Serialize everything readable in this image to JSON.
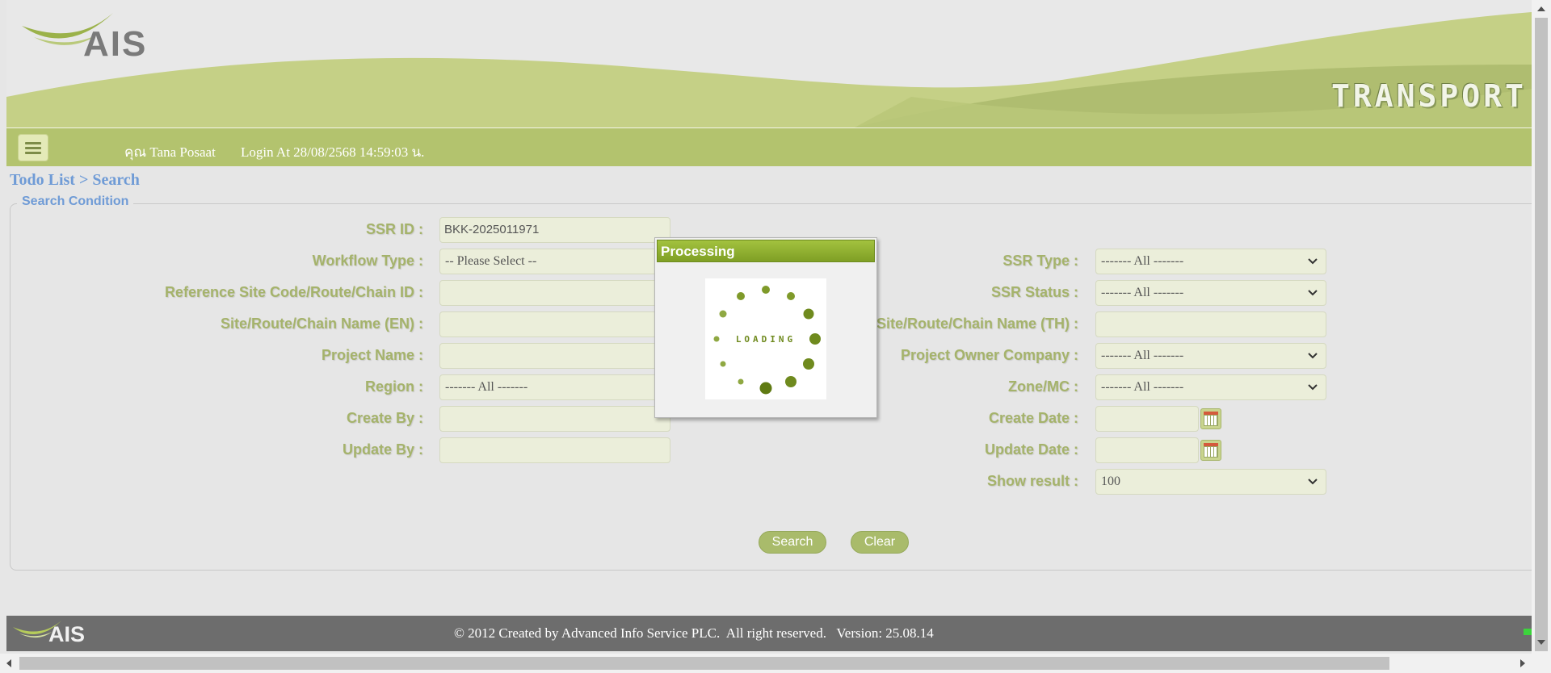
{
  "header": {
    "logo_text": "AIS",
    "brand_text": "TRANSPORT",
    "user_name": "คุณ Tana Posaat",
    "login_at": "Login At 28/08/2568 14:59:03 น."
  },
  "breadcrumb": "Todo List > Search",
  "search": {
    "legend": "Search Condition",
    "left": {
      "ssr_id_label": "SSR ID :",
      "ssr_id_value": "BKK-2025011971",
      "workflow_type_label": "Workflow Type :",
      "workflow_type_value": "-- Please Select --",
      "ref_site_label": "Reference Site Code/Route/Chain ID :",
      "ref_site_value": "",
      "site_name_en_label": "Site/Route/Chain Name (EN) :",
      "site_name_en_value": "",
      "project_name_label": "Project Name :",
      "project_name_value": "",
      "region_label": "Region :",
      "region_value": "------- All -------",
      "create_by_label": "Create By :",
      "create_by_value": "",
      "update_by_label": "Update By :",
      "update_by_value": ""
    },
    "right": {
      "ssr_type_label": "SSR Type :",
      "ssr_type_value": "------- All -------",
      "ssr_status_label": "SSR Status :",
      "ssr_status_value": "------- All -------",
      "site_name_th_label": "Site/Route/Chain Name (TH) :",
      "site_name_th_value": "",
      "project_owner_label": "Project Owner Company :",
      "project_owner_value": "------- All -------",
      "zone_mc_label": "Zone/MC :",
      "zone_mc_value": "------- All -------",
      "create_date_label": "Create Date :",
      "create_date_value": "",
      "update_date_label": "Update Date :",
      "update_date_value": "",
      "show_result_label": "Show result :",
      "show_result_value": "100"
    },
    "search_button": "Search",
    "clear_button": "Clear"
  },
  "footer": {
    "logo_text": "AIS",
    "copyright": "© 2012 Created by Advanced Info Service PLC.  All right reserved.   Version: 25.08.14"
  },
  "modal": {
    "title": "Processing",
    "loading_text": "LOADING"
  },
  "colors": {
    "accent_green": "#a5b36b",
    "topbar_green": "#b3c36e",
    "link_blue": "#6f9bd6",
    "modal_title_green": "#8faf2e"
  }
}
